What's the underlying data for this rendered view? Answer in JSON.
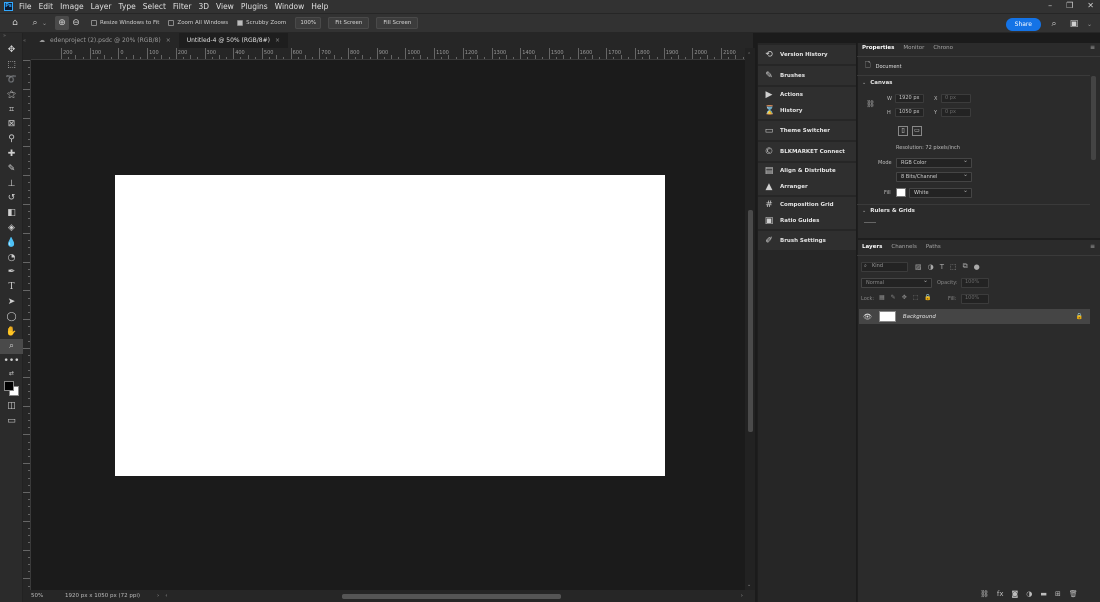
{
  "menubar": {
    "logo": "Ps",
    "items": [
      "File",
      "Edit",
      "Image",
      "Layer",
      "Type",
      "Select",
      "Filter",
      "3D",
      "View",
      "Plugins",
      "Window",
      "Help"
    ]
  },
  "options": {
    "resize_windows": "Resize Windows to Fit",
    "zoom_all": "Zoom All Windows",
    "scrubby_zoom": "Scrubby Zoom",
    "zoom_value": "100%",
    "fit_screen": "Fit Screen",
    "fill_screen": "Fill Screen",
    "share": "Share"
  },
  "tabs": [
    {
      "label": "edenproject (2).psdc @ 20% (RGB/8)",
      "active": false
    },
    {
      "label": "Untitled-4 @ 50% (RGB/8#)",
      "active": true
    }
  ],
  "ruler_labels": [
    "200",
    "100",
    "0",
    "100",
    "200",
    "300",
    "400",
    "500",
    "600",
    "700",
    "800",
    "900",
    "1000",
    "1100",
    "1200",
    "1300",
    "1400",
    "1500",
    "1600",
    "1700",
    "1800",
    "1900",
    "2000",
    "2100"
  ],
  "status": {
    "zoom": "50%",
    "doc_info": "1920 px x 1050 px (72 ppi)"
  },
  "mid_panels": [
    {
      "icon": "version-history-icon",
      "glyph": "⟲",
      "label": "Version History"
    },
    {
      "icon": "brushes-icon",
      "glyph": "✎",
      "label": "Brushes"
    },
    {
      "icon": "actions-icon",
      "glyph": "▶",
      "label": "Actions"
    },
    {
      "icon": "history-icon",
      "glyph": "⌛",
      "label": "History"
    },
    {
      "icon": "theme-switcher-icon",
      "glyph": "▭",
      "label": "Theme Switcher"
    },
    {
      "icon": "blkmarket-icon",
      "glyph": "©",
      "label": "BLKMARKET Connect"
    },
    {
      "icon": "align-icon",
      "glyph": "▤",
      "label": "Align & Distribute"
    },
    {
      "icon": "arranger-icon",
      "glyph": "▲",
      "label": "Arranger"
    },
    {
      "icon": "composition-grid-icon",
      "glyph": "#",
      "label": "Composition Grid"
    },
    {
      "icon": "ratio-guides-icon",
      "glyph": "▣",
      "label": "Ratio Guides"
    },
    {
      "icon": "brush-settings-icon",
      "glyph": "✐",
      "label": "Brush Settings"
    }
  ],
  "properties": {
    "tabs": [
      "Properties",
      "Monitor",
      "Chrono"
    ],
    "document_label": "Document",
    "canvas_label": "Canvas",
    "w_label": "W",
    "w_value": "1920 px",
    "h_label": "H",
    "h_value": "1050 px",
    "x_label": "X",
    "x_value": "0 px",
    "y_label": "Y",
    "y_value": "0 px",
    "resolution": "Resolution: 72 pixels/inch",
    "mode_label": "Mode",
    "mode_value": "RGB Color",
    "bits_value": "8 Bits/Channel",
    "fill_label": "Fill",
    "fill_value": "White",
    "rulers_label": "Rulers & Grids"
  },
  "layers": {
    "tabs": [
      "Layers",
      "Channels",
      "Paths"
    ],
    "kind_placeholder": "Kind",
    "blend_mode": "Normal",
    "opacity_label": "Opacity:",
    "opacity_value": "100%",
    "lock_label": "Lock:",
    "fill_label": "Fill:",
    "fill_value": "100%",
    "items": [
      {
        "name": "Background"
      }
    ]
  },
  "colors": {
    "accent": "#1473e6",
    "canvas": "#ffffff",
    "workspace": "#1b1b1b"
  }
}
